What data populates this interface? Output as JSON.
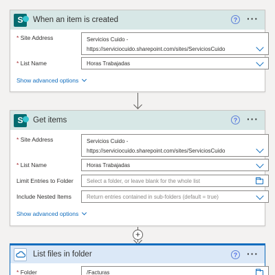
{
  "steps": [
    {
      "title": "When an item is created",
      "fields": [
        {
          "label": "Site Address",
          "required": true,
          "value_line1": "Servicios Cuido -",
          "value_line2": "https://serviciocuido.sharepoint.com/sites/ServiciosCuido"
        },
        {
          "label": "List Name",
          "required": true,
          "value": "Horas Trabajadas"
        }
      ],
      "advanced_link": "Show advanced options"
    },
    {
      "title": "Get items",
      "fields": [
        {
          "label": "Site Address",
          "required": true,
          "value_line1": "Servicios Cuido -",
          "value_line2": "https://serviciocuido.sharepoint.com/sites/ServiciosCuido"
        },
        {
          "label": "List Name",
          "required": true,
          "value": "Horas Trabajadas"
        },
        {
          "label": "Limit Entries to Folder",
          "required": false,
          "placeholder": "Select a folder, or leave blank for the whole list"
        },
        {
          "label": "Include Nested Items",
          "required": false,
          "placeholder": "Return entries contained in sub-folders (default = true)"
        }
      ],
      "advanced_link": "Show advanced options"
    },
    {
      "title": "List files in folder",
      "fields": [
        {
          "label": "Folder",
          "required": true,
          "value": "/Facturas"
        }
      ]
    }
  ],
  "icons": {
    "help": "?",
    "more": "···",
    "add": "+",
    "sharepoint_letter": "S"
  },
  "colors": {
    "sharepoint_header": "#d7e7e6",
    "onedrive_header": "#dbe8f7",
    "accent": "#0f6cbd",
    "required": "#a4262c"
  }
}
